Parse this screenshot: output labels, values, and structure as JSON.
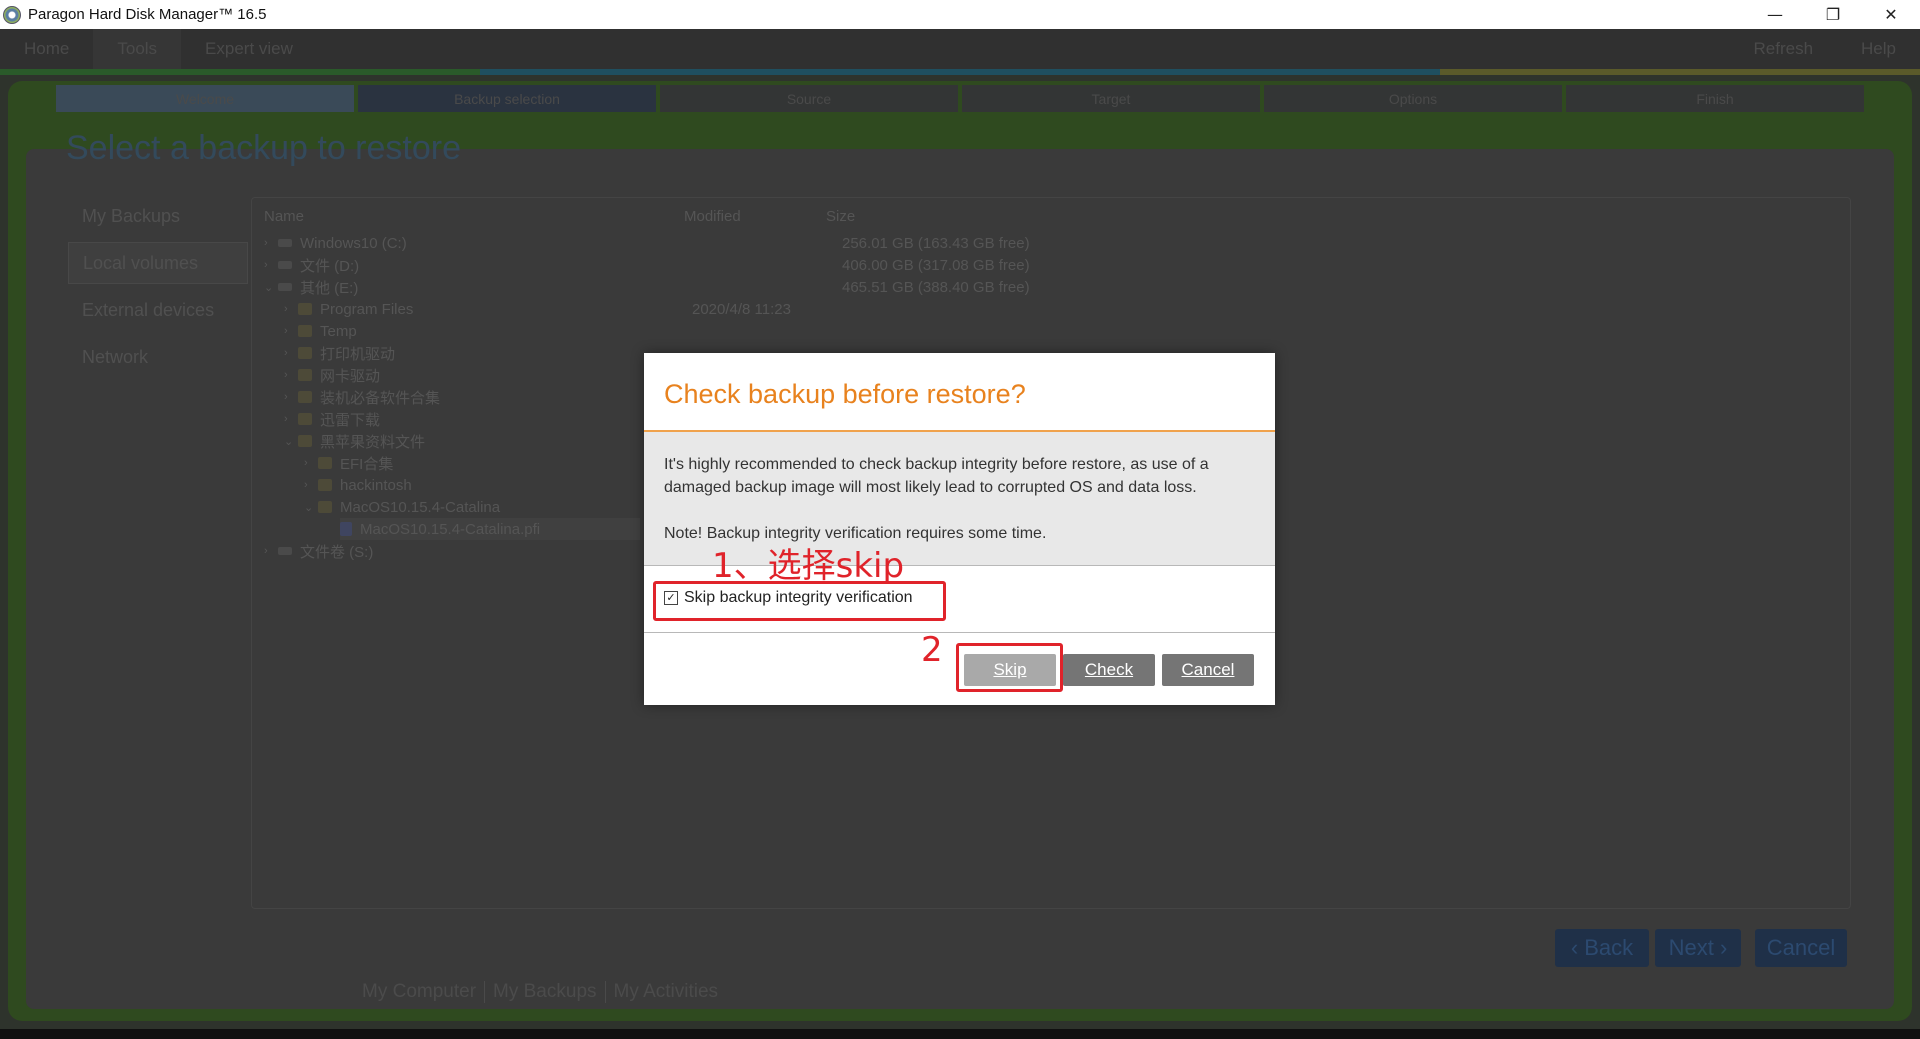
{
  "window": {
    "title": "Paragon Hard Disk Manager™ 16.5",
    "controls": {
      "minimize": "—",
      "restore": "❐",
      "close": "✕"
    }
  },
  "menubar": {
    "items": [
      "Home",
      "Tools",
      "Expert view"
    ],
    "right_items": [
      "Refresh",
      "Help"
    ]
  },
  "wizard": {
    "steps": [
      "Welcome",
      "Backup selection",
      "Source",
      "Target",
      "Options",
      "Finish"
    ],
    "page_title": "Select a backup to restore",
    "left_nav": [
      "My Backups",
      "Local volumes",
      "External devices",
      "Network"
    ],
    "table": {
      "headers": {
        "name": "Name",
        "modified": "Modified",
        "size": "Size"
      },
      "rows": [
        {
          "name": "Windows10 (C:)",
          "modified": "",
          "size": "256.01 GB (163.43 GB free)"
        },
        {
          "name": "文件 (D:)",
          "modified": "",
          "size": "406.00 GB (317.08 GB free)"
        },
        {
          "name": "其他 (E:)",
          "modified": "",
          "size": "465.51 GB (388.40 GB free)"
        },
        {
          "name": "Program Files",
          "modified": "2020/4/8 11:23",
          "size": ""
        },
        {
          "name": "Temp",
          "modified": "",
          "size": ""
        },
        {
          "name": "打印机驱动",
          "modified": "",
          "size": ""
        },
        {
          "name": "网卡驱动",
          "modified": "",
          "size": ""
        },
        {
          "name": "装机必备软件合集",
          "modified": "",
          "size": ""
        },
        {
          "name": "迅雷下载",
          "modified": "",
          "size": ""
        },
        {
          "name": "黑苹果资料文件",
          "modified": "",
          "size": ""
        },
        {
          "name": "EFI合集",
          "modified": "",
          "size": ""
        },
        {
          "name": "hackintosh",
          "modified": "",
          "size": ""
        },
        {
          "name": "MacOS10.15.4-Catalina",
          "modified": "",
          "size": ""
        },
        {
          "name": "MacOS10.15.4-Catalina.pfi",
          "modified": "",
          "size": ""
        },
        {
          "name": "文件卷 (S:)",
          "modified": "",
          "size": ""
        }
      ]
    },
    "footer_buttons": {
      "back": "‹ Back",
      "next": "Next ›",
      "cancel": "Cancel"
    },
    "bottom_tabs": [
      "My Computer",
      "My Backups",
      "My Activities"
    ]
  },
  "dialog": {
    "title": "Check backup before restore?",
    "body_p1": "It's highly recommended to check backup integrity before restore, as use of a damaged backup image will most likely lead to corrupted OS and data loss.",
    "body_p2": "Note! Backup integrity verification requires some time.",
    "checkbox_label": "Skip backup integrity verification",
    "checkbox_checked": true,
    "checkbox_mark": "✓",
    "buttons": {
      "skip": "Skip",
      "check": "Check",
      "cancel": "Cancel"
    }
  },
  "annotations": {
    "step1": "1、选择skip",
    "step2": "2",
    "color": "#e0232a"
  },
  "colors": {
    "dialog_title": "#e8821e",
    "dialog_rule": "#f0a24c"
  }
}
